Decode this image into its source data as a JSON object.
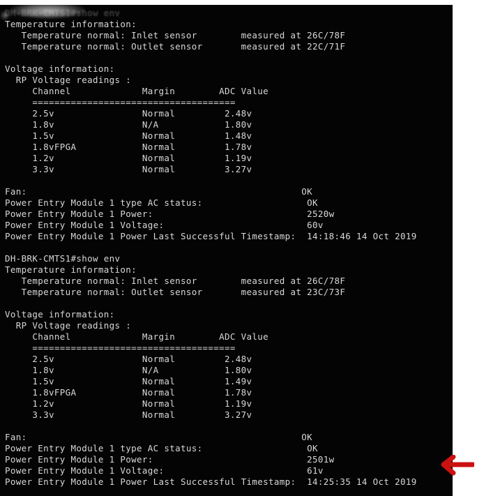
{
  "terminal": {
    "background_color": "#040404",
    "text_color": "#d8d8d8",
    "blocks": [
      {
        "prompt_line": "DH-BRK-CMTS1#show env",
        "prompt_obscured": true,
        "temperature_header": "Temperature information:",
        "temperature_rows": [
          {
            "label": "   Temperature normal: Inlet sensor",
            "measured": "measured at 26C/78F"
          },
          {
            "label": "   Temperature normal: Outlet sensor",
            "measured": "measured at 22C/71F"
          }
        ],
        "voltage_header": "Voltage information:",
        "voltage_subheader": "  RP Voltage readings :",
        "voltage_columns": [
          "Channel",
          "Margin",
          "ADC Value"
        ],
        "voltage_separator": "=====================================",
        "voltage_rows": [
          {
            "channel": "2.5v",
            "margin": "Normal",
            "adc": "2.48v"
          },
          {
            "channel": "1.8v",
            "margin": "N/A",
            "adc": "1.80v"
          },
          {
            "channel": "1.5v",
            "margin": "Normal",
            "adc": "1.48v"
          },
          {
            "channel": "1.8vFPGA",
            "margin": "Normal",
            "adc": "1.78v"
          },
          {
            "channel": "1.2v",
            "margin": "Normal",
            "adc": "1.19v"
          },
          {
            "channel": "3.3v",
            "margin": "Normal",
            "adc": "3.27v"
          }
        ],
        "status_rows": [
          {
            "label": "Fan:",
            "value": "OK"
          },
          {
            "label": "Power Entry Module 1 type AC status:",
            "value": "OK"
          },
          {
            "label": "Power Entry Module 1 Power:",
            "value": "2520w"
          },
          {
            "label": "Power Entry Module 1 Voltage:",
            "value": "60v"
          },
          {
            "label": "Power Entry Module 1 Power Last Successful Timestamp:",
            "value": "14:18:46 14 Oct 2019"
          }
        ]
      },
      {
        "prompt_line": "DH-BRK-CMTS1#show env",
        "prompt_obscured": false,
        "temperature_header": "Temperature information:",
        "temperature_rows": [
          {
            "label": "   Temperature normal: Inlet sensor",
            "measured": "measured at 26C/78F"
          },
          {
            "label": "   Temperature normal: Outlet sensor",
            "measured": "measured at 23C/73F"
          }
        ],
        "voltage_header": "Voltage information:",
        "voltage_subheader": "  RP Voltage readings :",
        "voltage_columns": [
          "Channel",
          "Margin",
          "ADC Value"
        ],
        "voltage_separator": "=====================================",
        "voltage_rows": [
          {
            "channel": "2.5v",
            "margin": "Normal",
            "adc": "2.48v"
          },
          {
            "channel": "1.8v",
            "margin": "N/A",
            "adc": "1.80v"
          },
          {
            "channel": "1.5v",
            "margin": "Normal",
            "adc": "1.49v"
          },
          {
            "channel": "1.8vFPGA",
            "margin": "Normal",
            "adc": "1.78v"
          },
          {
            "channel": "1.2v",
            "margin": "Normal",
            "adc": "1.19v"
          },
          {
            "channel": "3.3v",
            "margin": "Normal",
            "adc": "3.27v"
          }
        ],
        "status_rows": [
          {
            "label": "Fan:",
            "value": "OK"
          },
          {
            "label": "Power Entry Module 1 type AC status:",
            "value": "OK"
          },
          {
            "label": "Power Entry Module 1 Power:",
            "value": "2501w"
          },
          {
            "label": "Power Entry Module 1 Voltage:",
            "value": "61v"
          },
          {
            "label": "Power Entry Module 1 Power Last Successful Timestamp:",
            "value": "14:25:35 14 Oct 2019"
          }
        ]
      }
    ]
  },
  "annotation": {
    "arrow_color": "#cc1111",
    "arrow_direction": "left",
    "points_at": "Power Entry Module 1 Power: 2501w"
  },
  "composed_lines": {
    "b0": {
      "l00": "DH-BRK-CMTS1#show env",
      "l01": "Temperature information:",
      "l02": "   Temperature normal: Inlet sensor        measured at 26C/78F",
      "l03": "   Temperature normal: Outlet sensor       measured at 22C/71F",
      "l04": "",
      "l05": "Voltage information:",
      "l06": "  RP Voltage readings :",
      "l07": "     Channel             Margin        ADC Value",
      "l08": "     =====================================",
      "l09": "     2.5v                Normal         2.48v",
      "l10": "     1.8v                N/A            1.80v",
      "l11": "     1.5v                Normal         1.48v",
      "l12": "     1.8vFPGA            Normal         1.78v",
      "l13": "     1.2v                Normal         1.19v",
      "l14": "     3.3v                Normal         3.27v",
      "l15": "",
      "l16": "Fan:                                                  OK",
      "l17": "Power Entry Module 1 type AC status:                   OK",
      "l18": "Power Entry Module 1 Power:                            2520w",
      "l19": "Power Entry Module 1 Voltage:                          60v",
      "l20": "Power Entry Module 1 Power Last Successful Timestamp:  14:18:46 14 Oct 2019",
      "l21": ""
    },
    "b1": {
      "l00": "DH-BRK-CMTS1#show env",
      "l01": "Temperature information:",
      "l02": "   Temperature normal: Inlet sensor        measured at 26C/78F",
      "l03": "   Temperature normal: Outlet sensor       measured at 23C/73F",
      "l04": "",
      "l05": "Voltage information:",
      "l06": "  RP Voltage readings :",
      "l07": "     Channel             Margin        ADC Value",
      "l08": "     =====================================",
      "l09": "     2.5v                Normal         2.48v",
      "l10": "     1.8v                N/A            1.80v",
      "l11": "     1.5v                Normal         1.49v",
      "l12": "     1.8vFPGA            Normal         1.78v",
      "l13": "     1.2v                Normal         1.19v",
      "l14": "     3.3v                Normal         3.27v",
      "l15": "",
      "l16": "Fan:                                                  OK",
      "l17": "Power Entry Module 1 type AC status:                   OK",
      "l18": "Power Entry Module 1 Power:                            2501w",
      "l19": "Power Entry Module 1 Voltage:                          61v",
      "l20": "Power Entry Module 1 Power Last Successful Timestamp:  14:25:35 14 Oct 2019"
    }
  }
}
